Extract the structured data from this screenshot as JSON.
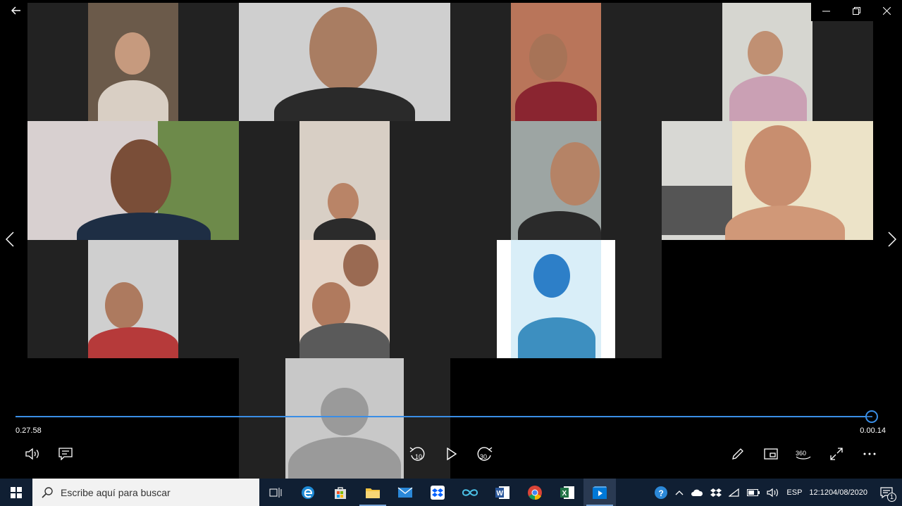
{
  "player": {
    "elapsed": "0.27.58",
    "remaining": "0.00.14",
    "progress_fraction": 0.999
  },
  "icons": {
    "back": "back-arrow-icon",
    "prev": "chevron-left-icon",
    "next": "chevron-right-icon"
  },
  "controls": {
    "skip_back_label": "10",
    "skip_forward_label": "30",
    "vr_label": "360"
  },
  "taskbar": {
    "search_placeholder": "Escribe aquí para buscar",
    "language": "ESP",
    "time": "12:12",
    "date": "04/08/2020",
    "notification_count": "1"
  },
  "colors": {
    "accent": "#3a8ee6",
    "taskbar": "#101f33"
  }
}
